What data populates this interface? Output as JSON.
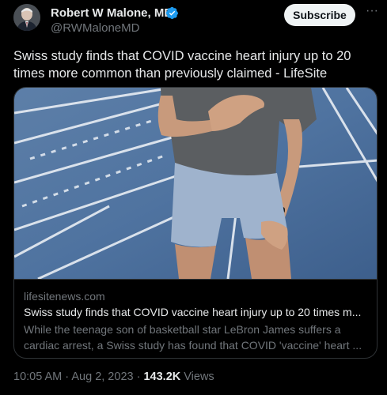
{
  "author": {
    "name": "Robert W Malone, MD",
    "handle": "@RWMaloneMD",
    "verified_icon": "verified-badge-icon",
    "accent_color": "#1d9bf0"
  },
  "actions": {
    "subscribe_label": "Subscribe",
    "more_icon": "more-options-icon",
    "more_glyph": "···"
  },
  "tweet": {
    "text": "Swiss study finds that COVID vaccine heart injury up to 20 times more common than previously claimed - LifeSite"
  },
  "card": {
    "image_icon": "runner-on-track-photo",
    "domain": "lifesitenews.com",
    "title": "Swiss study finds that COVID vaccine heart injury up to 20 times m...",
    "description": "While the teenage son of basketball star LeBron James suffers a cardiac arrest, a Swiss study has found that COVID 'vaccine' heart ..."
  },
  "footer": {
    "time": "10:05 AM",
    "separator": " · ",
    "date": "Aug 2, 2023",
    "views_count": "143.2K",
    "views_label": "Views"
  }
}
